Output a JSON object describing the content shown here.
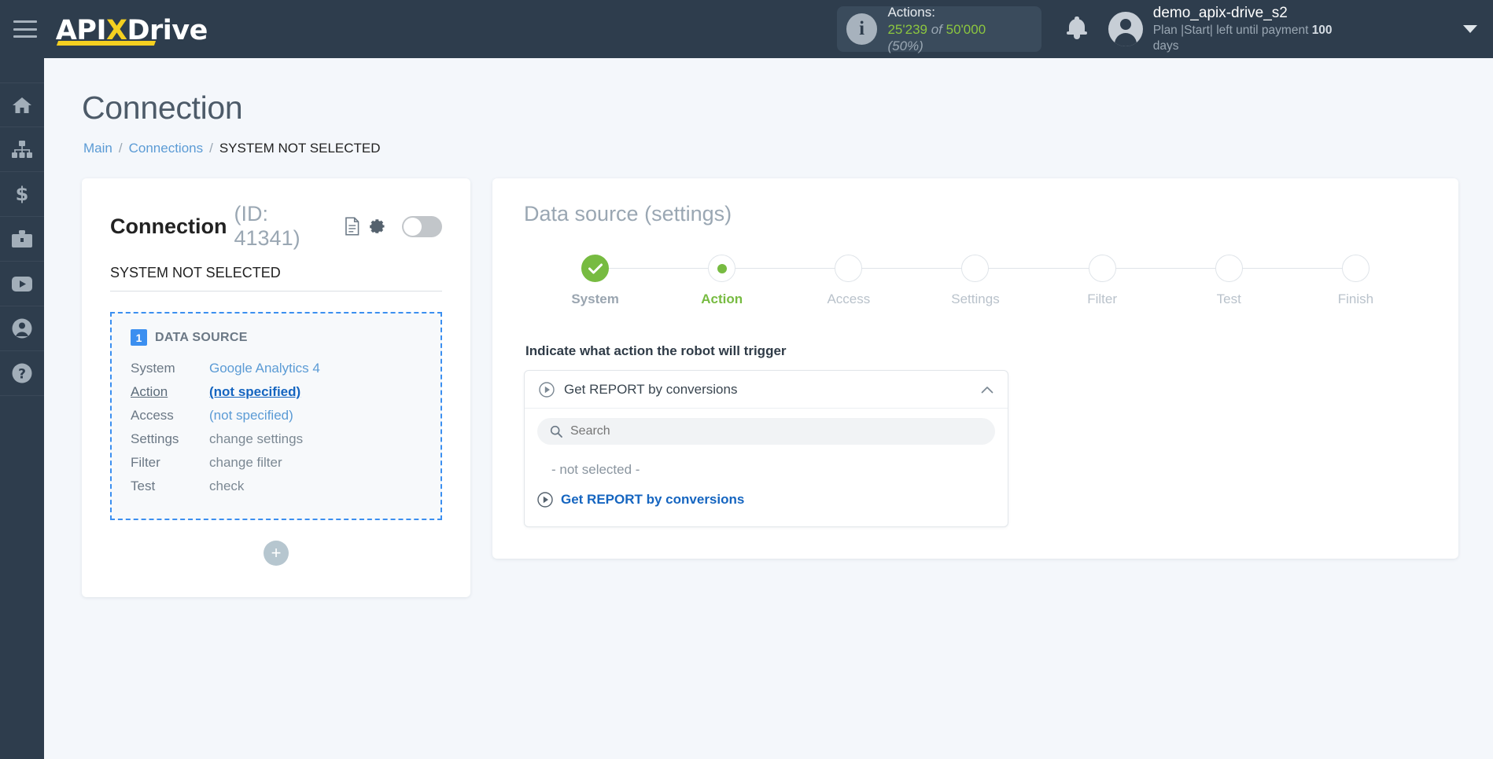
{
  "topbar": {
    "logo_main": "API",
    "logo_x": "X",
    "logo_tail": "Drive",
    "actions_label": "Actions:",
    "actions_used": "25'239",
    "actions_of": "of",
    "actions_total": "50'000",
    "actions_percent": "(50%)",
    "user_name": "demo_apix-drive_s2",
    "plan_prefix": "Plan |Start| left until payment ",
    "plan_days": "100",
    "plan_suffix": " days"
  },
  "rail": {
    "items": [
      {
        "name": "home-icon",
        "label": "Home"
      },
      {
        "name": "sitemap-icon",
        "label": "Connections"
      },
      {
        "name": "dollar-icon",
        "label": "Payments"
      },
      {
        "name": "briefcase-icon",
        "label": "Business"
      },
      {
        "name": "youtube-icon",
        "label": "Video"
      },
      {
        "name": "user-icon",
        "label": "Profile"
      },
      {
        "name": "help-icon",
        "label": "Help"
      }
    ]
  },
  "page": {
    "title": "Connection",
    "breadcrumb": {
      "main": "Main",
      "sep": "/",
      "connections": "Connections",
      "current": "SYSTEM NOT SELECTED"
    }
  },
  "connection_card": {
    "title": "Connection",
    "id_text": "(ID: 41341)",
    "subtitle": "SYSTEM NOT SELECTED",
    "badge_number": "1",
    "section_title": "DATA SOURCE",
    "rows": [
      {
        "key": "System",
        "value": "Google Analytics 4",
        "style": "link"
      },
      {
        "key": "Action",
        "value": "(not specified)",
        "style": "strong"
      },
      {
        "key": "Access",
        "value": "(not specified)",
        "style": "link"
      },
      {
        "key": "Settings",
        "value": "change settings",
        "style": "muted"
      },
      {
        "key": "Filter",
        "value": "change filter",
        "style": "muted"
      },
      {
        "key": "Test",
        "value": "check",
        "style": "muted"
      }
    ],
    "add_label": "+"
  },
  "settings_panel": {
    "title": "Data source",
    "title_suffix": "(settings)",
    "steps": [
      {
        "label": "System",
        "state": "done"
      },
      {
        "label": "Action",
        "state": "current"
      },
      {
        "label": "Access",
        "state": "todo"
      },
      {
        "label": "Settings",
        "state": "todo"
      },
      {
        "label": "Filter",
        "state": "todo"
      },
      {
        "label": "Test",
        "state": "todo"
      },
      {
        "label": "Finish",
        "state": "todo"
      }
    ],
    "field_label": "Indicate what action the robot will trigger",
    "select": {
      "value": "Get REPORT by conversions",
      "search_placeholder": "Search",
      "search_value": "",
      "options": [
        {
          "label": "- not selected -",
          "selected": false
        },
        {
          "label": "Get REPORT by conversions",
          "selected": true
        }
      ]
    }
  },
  "colors": {
    "header_bg": "#2e3d4d",
    "accent_yellow": "#f5d020",
    "accent_blue": "#3b8ff0",
    "accent_green": "#77bb41",
    "link_blue": "#5b9bd5",
    "page_bg": "#f4f7fb"
  }
}
